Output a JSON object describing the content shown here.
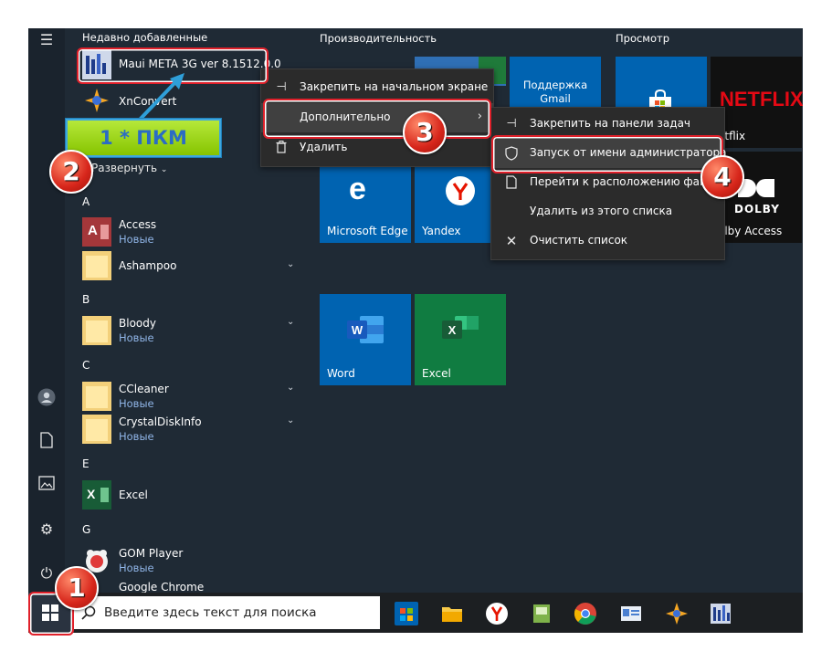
{
  "sections": {
    "recent": "Недавно добавленные",
    "productivity": "Производительность",
    "browse": "Просмотр"
  },
  "recent_items": {
    "maui": "Maui META 3G ver 8.1512.0.0",
    "xnconvert": "XnConvert",
    "expand": "Развернуть"
  },
  "annotation": {
    "callout": "1 * ПКМ",
    "badge1": "1",
    "badge2": "2",
    "badge3": "3",
    "badge4": "4"
  },
  "apps": [
    {
      "letter": "A"
    },
    {
      "name": "Access",
      "sub": "Новые"
    },
    {
      "name": "Ashampoo"
    },
    {
      "letter": "B"
    },
    {
      "name": "Bloody",
      "sub": "Новые"
    },
    {
      "letter": "C"
    },
    {
      "name": "CCleaner",
      "sub": "Новые"
    },
    {
      "name": "CrystalDiskInfo",
      "sub": "Новые"
    },
    {
      "letter": "E"
    },
    {
      "name": "Excel"
    },
    {
      "letter": "G"
    },
    {
      "name": "GOM Player",
      "sub": "Новые"
    },
    {
      "name": "Google Chrome"
    }
  ],
  "tiles": {
    "gmail": "Поддержка Gmail",
    "netflix_logo": "NETFLIX",
    "netflix": "etflix",
    "edge": "Microsoft Edge",
    "yandex": "Yandex",
    "dolby_logo": "DOLBY",
    "dolby": "olby Access",
    "word": "Word",
    "excel": "Excel"
  },
  "context_menu": {
    "pin_start": "Закрепить на начальном экране",
    "more": "Дополнительно",
    "uninstall": "Удалить"
  },
  "submenu": {
    "pin_taskbar": "Закрепить на панели задач",
    "run_admin": "Запуск от имени администратора",
    "open_location": "Перейти к расположению файла",
    "remove_list": "Удалить из этого списка",
    "clear_list": "Очистить список"
  },
  "search": {
    "placeholder": "Введите здесь текст для поиска"
  },
  "colors": {
    "accent_blue": "#0063b1",
    "tile_green": "#107c41",
    "annotation_red": "#e0202a",
    "callout_green": "#8fd400"
  }
}
